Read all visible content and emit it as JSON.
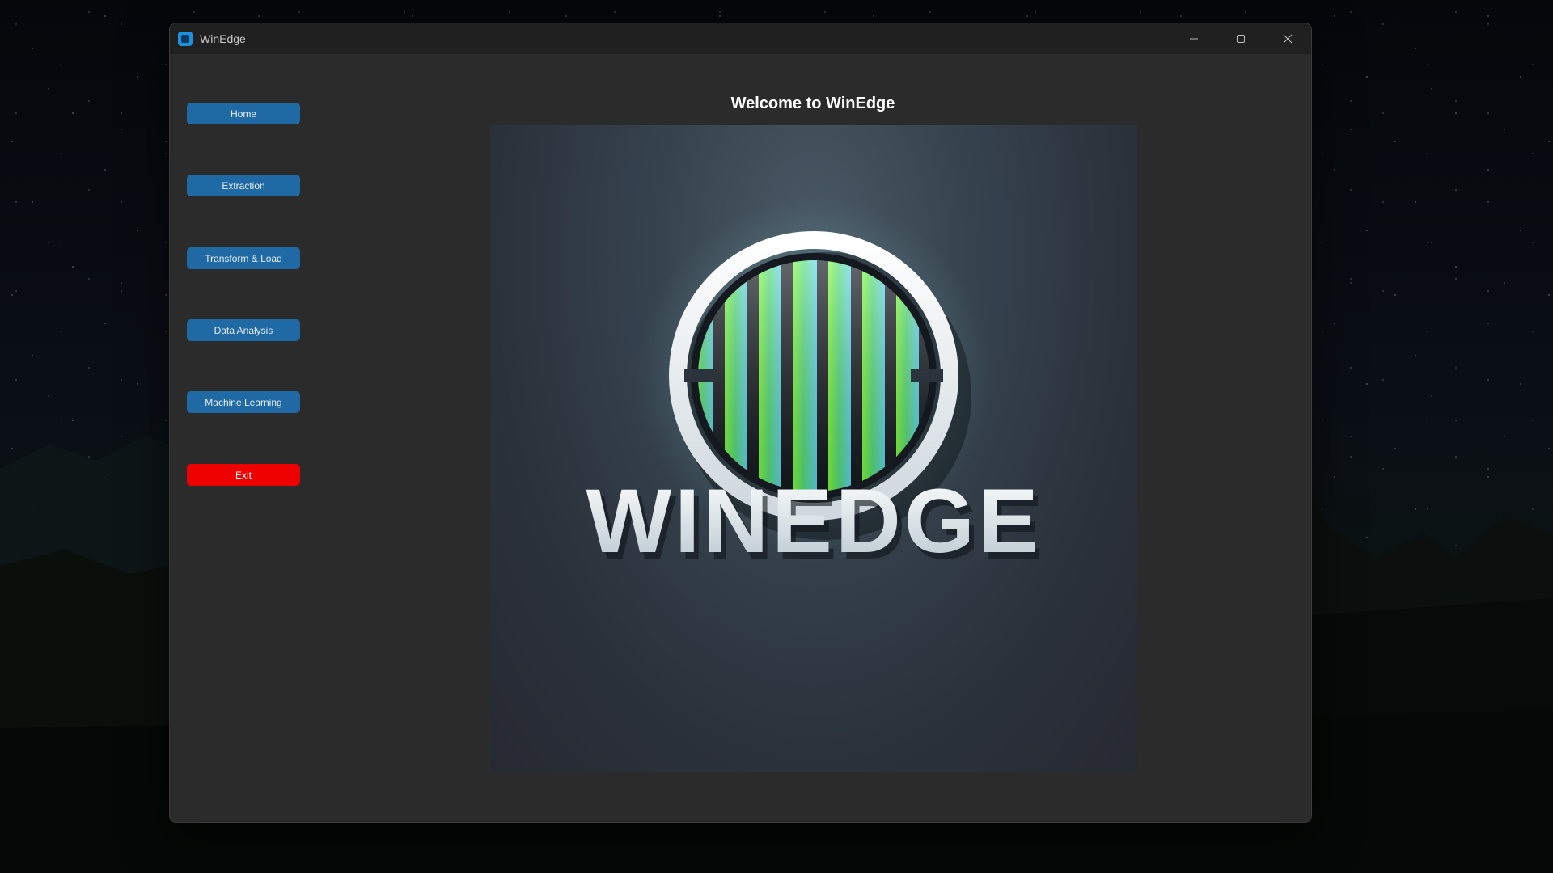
{
  "window": {
    "title": "WinEdge",
    "controls": {
      "minimize": "minimize-icon",
      "maximize": "maximize-icon",
      "close": "close-icon"
    }
  },
  "sidebar": {
    "items": [
      {
        "label": "Home"
      },
      {
        "label": "Extraction"
      },
      {
        "label": "Transform & Load"
      },
      {
        "label": "Data Analysis"
      },
      {
        "label": "Machine Learning"
      }
    ],
    "exit_label": "Exit"
  },
  "main": {
    "heading": "Welcome to WinEdge",
    "logo": {
      "wordmark": "WINEDGE",
      "icon": "striped-circle-logo"
    }
  },
  "colors": {
    "window_bg": "#2b2b2b",
    "titlebar_bg": "#202020",
    "nav_button": "#1f6aa5",
    "exit_button": "#ee0000",
    "accent_green": "#7dff3a",
    "accent_cyan": "#5fd8f0"
  }
}
